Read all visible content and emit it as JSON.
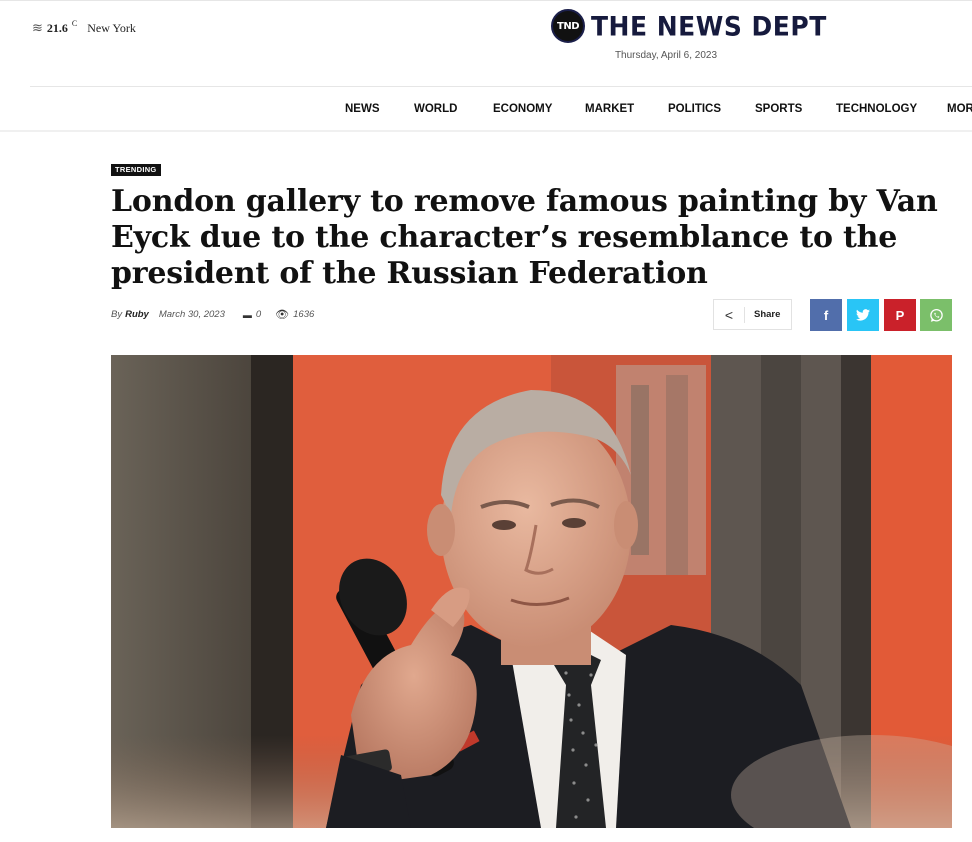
{
  "weather": {
    "icon": "wind-icon",
    "temperature": "21.6",
    "unit": "C",
    "city": "New York"
  },
  "site": {
    "logo_mark": "TND",
    "name": "THE NEWS DEPT",
    "date": "Thursday, April 6, 2023"
  },
  "nav": {
    "items": [
      "NEWS",
      "WORLD",
      "ECONOMY",
      "MARKET",
      "POLITICS",
      "SPORTS",
      "TECHNOLOGY",
      "MOR"
    ]
  },
  "article": {
    "tag": "TRENDING",
    "title": "London gallery to remove famous painting by Van Eyck due to the character’s resemblance to the president of the Russian Federation",
    "by": "By",
    "author": "Ruby",
    "date": "March 30, 2023",
    "comments": "0",
    "views": "1636",
    "image": "Man in a dark suit and polka-dot tie holding a microphone in front of an orange wall"
  },
  "share": {
    "label": "Share",
    "icons": [
      "share-icon",
      "facebook-icon",
      "twitter-icon",
      "pinterest-icon",
      "whatsapp-icon"
    ],
    "colors": {
      "facebook": "#516eab",
      "twitter": "#29c5f6",
      "pinterest": "#ca212a",
      "whatsapp": "#7bbf6a"
    }
  }
}
